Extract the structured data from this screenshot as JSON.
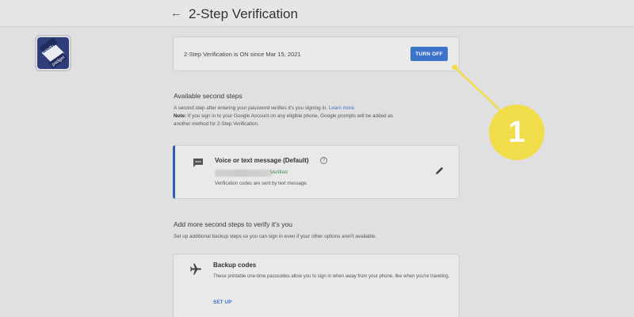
{
  "header": {
    "back_icon": "arrow-left-icon",
    "title": "2-Step Verification"
  },
  "logo": {
    "text_top": "pandu",
    "text_bottom": "padget"
  },
  "status": {
    "text": "2-Step Verification is ON since Mar 15, 2021",
    "button_label": "TURN OFF",
    "button_color": "#3d72c9"
  },
  "available": {
    "heading": "Available second steps",
    "line1": "A second step after entering your password verifies it's you signing in.",
    "learn_more": "Learn more",
    "note_label": "Note:",
    "note_text": " If you sign in to your Google Account on any eligible phone, Google prompts will be added as",
    "note_text2": "another method for 2-Step Verification."
  },
  "voice": {
    "icon": "message-icon",
    "title": "Voice or text message (Default)",
    "help_icon": "help-circle-icon",
    "verified": "Verified",
    "description": "Verification codes are sent by text message.",
    "edit_icon": "pencil-icon",
    "accent_color": "#2b5eb3"
  },
  "more": {
    "heading": "Add more second steps to verify it's you",
    "description": "Set up additional backup steps so you can sign in even if your other options aren't available."
  },
  "backup": {
    "icon": "airplane-icon",
    "title": "Backup codes",
    "description": "These printable one-time passcodes allow you to sign in when away from your phone, like when you're traveling.",
    "setup_label": "SET UP"
  },
  "callout": {
    "number": "1",
    "color": "#f1dc4a"
  }
}
